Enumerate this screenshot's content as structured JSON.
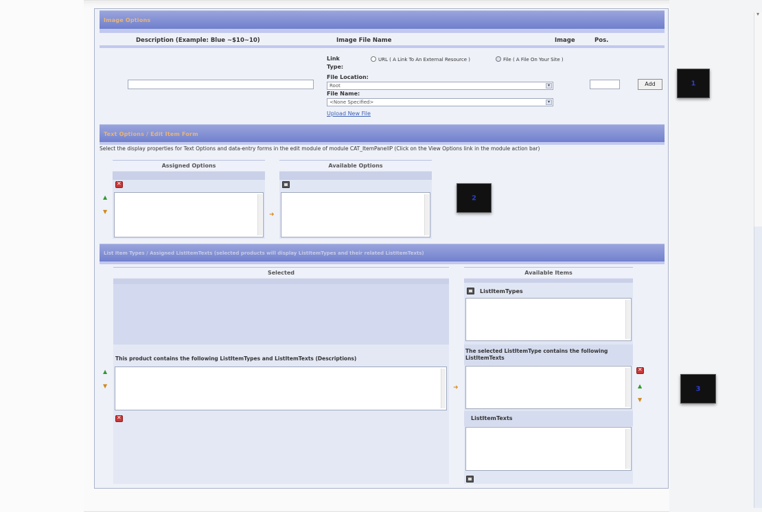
{
  "image_options": {
    "header": "Image Options",
    "col_description": "Description (Example: Blue ~$10~10)",
    "col_file": "Image File Name",
    "col_image": "Image",
    "col_pos": "Pos.",
    "link_type_label": "Link Type:",
    "radio_url_label": "URL ( A Link To An External Resource )",
    "radio_file_label": "File ( A File On Your Site )",
    "file_location_label": "File Location:",
    "file_location_value": "Root",
    "file_name_label": "File Name:",
    "file_name_value": "<None Specified>",
    "upload_link": "Upload New File",
    "add_button": "Add",
    "badge": "1"
  },
  "text_options": {
    "header": "Text Options / Edit Item Form",
    "instruction": "Select the display properties for Text Options and data-entry forms in the edit module of module CAT_ItemPanelIP (Click on the View Options link in the module action bar)",
    "assigned_head": "Assigned Options",
    "available_head": "Available Options",
    "badge": "2"
  },
  "list_items": {
    "header": "List Item Types / Assigned ListItemTexts (selected products will display ListItemTypes and their related ListItemTexts)",
    "selected_head": "Selected",
    "available_head": "Available Items",
    "types_label": "ListItemTypes",
    "contains_label": "This product contains the following ListItemTypes and ListItemTexts (Descriptions)",
    "selected_type_label": "The selected ListItemType contains the following ListItemTexts",
    "texts_label": "ListItemTexts",
    "badge": "3"
  },
  "icons": {
    "delete": "delete-icon",
    "add": "add-icon",
    "move_up": "move-up-icon",
    "move_down": "move-down-icon",
    "transfer": "transfer-arrow-icon"
  },
  "colors": {
    "header_top": "#9aa5dd",
    "header_bottom": "#6f7fcc",
    "header_text": "#e8b679",
    "panel_bg": "#eef1f8",
    "badge_bg": "#111111",
    "badge_text": "#2d3ecf"
  }
}
